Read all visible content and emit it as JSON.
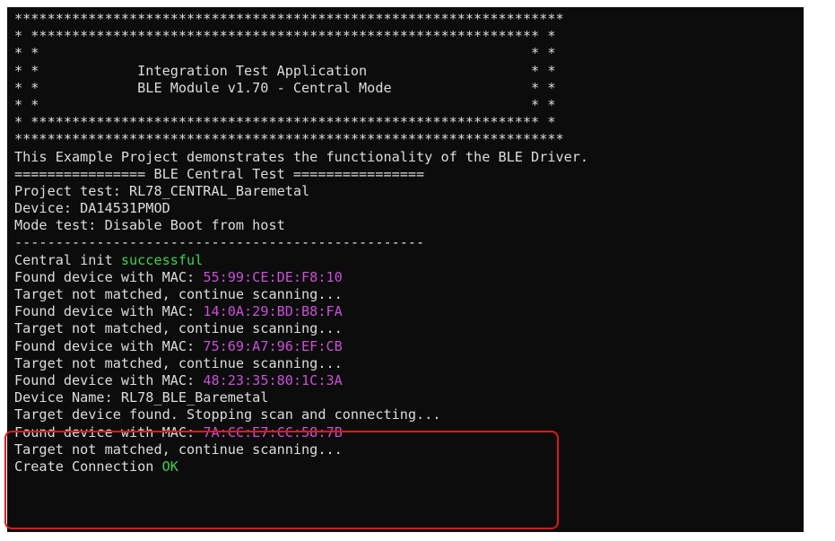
{
  "terminal": {
    "banner": [
      "*******************************************************************",
      "* ************************************************************** *",
      "* *                                                            * *",
      "* *            Integration Test Application                    * *",
      "* *            BLE Module v1.70 - Central Mode                 * *",
      "* *                                                            * *",
      "* ************************************************************** *",
      "*******************************************************************"
    ],
    "intro": "This Example Project demonstrates the functionality of the BLE Driver.",
    "section_header": "================ BLE Central Test ================",
    "project_test": "Project test: RL78_CENTRAL_Baremetal",
    "device": "Device: DA14531PMOD",
    "mode_test": "Mode test: Disable Boot from host",
    "separator": "--------------------------------------------------",
    "central_init_prefix": "Central init ",
    "central_init_status": "successful",
    "found_prefix": "Found device with MAC: ",
    "not_matched": "Target not matched, continue scanning...",
    "macs": [
      "55:99:CE:DE:F8:10",
      "14:0A:29:BD:B8:FA",
      "75:69:A7:96:EF:CB",
      "48:23:35:80:1C:3A",
      "7A:CC:E7:CC:58:7B"
    ],
    "device_name": "Device Name: RL78_BLE_Baremetal",
    "target_found": "Target device found. Stopping scan and connecting...",
    "create_connection_prefix": "Create Connection ",
    "create_connection_status": "OK"
  },
  "colors": {
    "background": "#0c0c0c",
    "text": "#dcdcdc",
    "success": "#39d353",
    "mac": "#c94fd6",
    "highlight_border": "#e01818"
  }
}
